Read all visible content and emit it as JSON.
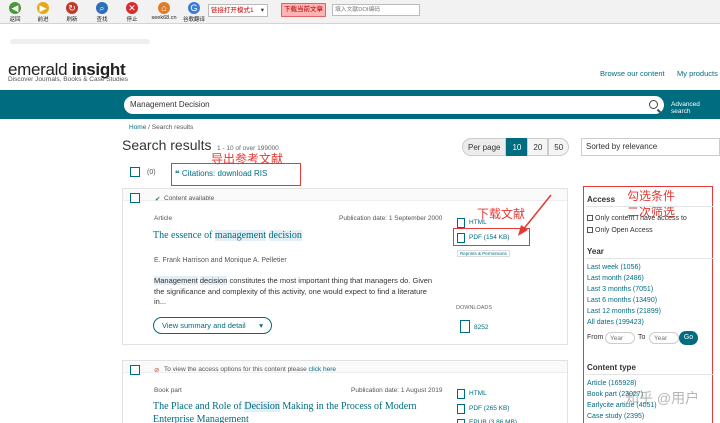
{
  "toolbar": {
    "buttons": [
      "返回",
      "前进",
      "刷新",
      "查找",
      "停止",
      "seek68.cn",
      "谷歌翻译"
    ],
    "mode_select": "链接打开模式1",
    "download_btn": "下载当前文章",
    "doi_placeholder": "填入文献DOI编码",
    "colors": [
      "#4a9a3a",
      "#e6a817",
      "#c0392b",
      "#2d6fb8",
      "#d32f2f",
      "#e07b2a",
      "#3b7dd8"
    ]
  },
  "header": {
    "logo_light": "emerald",
    "logo_bold": "insight",
    "tagline": "Discover Journals, Books & Case Studies",
    "nav": [
      "Browse our content",
      "My products"
    ]
  },
  "search": {
    "value": "Management Decision",
    "advanced": "Advanced search"
  },
  "breadcrumb": [
    "Home",
    "Search results"
  ],
  "results": {
    "heading": "Search results",
    "count": "1 - 10 of over 199000",
    "per_page_label": "Per page",
    "per_page": [
      "10",
      "20",
      "50"
    ],
    "sort": "Sorted by relevance",
    "selected": "(0)",
    "citations": "Citations: download RIS"
  },
  "annotations": {
    "export": "导出参考文献",
    "download": "下载文献",
    "filter_1": "勾选条件",
    "filter_2": "二次筛选"
  },
  "item1": {
    "access": "Content available",
    "type": "Article",
    "pubdate": "Publication date: 1 September 2000",
    "title_pre": "The essence of ",
    "title_hl1": "management",
    "title_mid": " ",
    "title_hl2": "decision",
    "authors": "E. Frank Harrison and Monique A. Pelletier",
    "abstract_hl1": "Management",
    "abstract_sp": " ",
    "abstract_hl2": "decision",
    "abstract_rest": " constitutes the most important thing that managers do. Given the significance and complexity of this activity, one would expect to find a literature in...",
    "view_btn": "View summary and detail",
    "html": "HTML",
    "pdf": "PDF (154 KB)",
    "reprints": "Reprints & Permissions",
    "downloads_label": "DOWNLOADS",
    "downloads": "8252"
  },
  "item2": {
    "access_pre": "To view the access options for this content please ",
    "access_link": "click here",
    "type": "Book part",
    "pubdate": "Publication date: 1 August 2019",
    "title_pre": "The Place and Role of ",
    "title_hl": "Decision",
    "title_rest": " Making in the Process of Modern",
    "title_line2": "Enterprise Management",
    "html": "HTML",
    "pdf": "PDF (265 KB)",
    "epub": "EPUB (3.86 MB)"
  },
  "sidebar": {
    "access_title": "Access",
    "access_options": [
      "Only content I have access to",
      "Only Open Access"
    ],
    "year_title": "Year",
    "years": [
      "Last week (1056)",
      "Last month (2486)",
      "Last 3 months (7051)",
      "Last 6 months (13490)",
      "Last 12 months (21899)",
      "All dates (199423)"
    ],
    "from": "From",
    "to": "To",
    "year_placeholder": "Year",
    "go": "Go",
    "type_title": "Content type",
    "types": [
      "Article (165928)",
      "Book part (23027)",
      "Earlycite article (4051)",
      "Case study (2395)"
    ]
  },
  "watermark": "知乎 @用户"
}
